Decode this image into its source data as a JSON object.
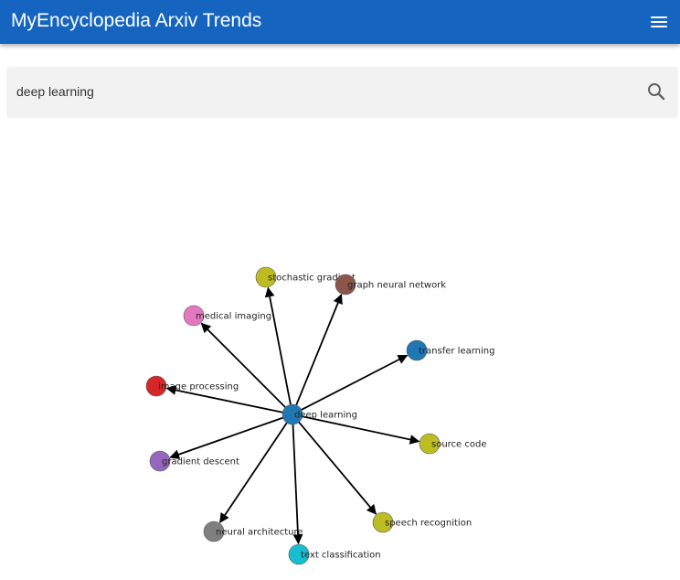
{
  "app": {
    "title": "MyEncyclopedia Arxiv Trends"
  },
  "icons": {
    "menu": "hamburger-menu-icon",
    "search": "search-icon"
  },
  "search": {
    "value": "deep learning"
  },
  "graph": {
    "center": {
      "label": "deep learning",
      "color": "#1f77b4"
    },
    "nodes": [
      {
        "label": "stochastic gradient",
        "color": "#bcbd22"
      },
      {
        "label": "graph neural network",
        "color": "#8c564b"
      },
      {
        "label": "medical imaging",
        "color": "#e377c2"
      },
      {
        "label": "transfer learning",
        "color": "#1f77b4"
      },
      {
        "label": "image processing",
        "color": "#d62728"
      },
      {
        "label": "source code",
        "color": "#bcbd22"
      },
      {
        "label": "gradient descent",
        "color": "#9467bd"
      },
      {
        "label": "speech recognition",
        "color": "#bcbd22"
      },
      {
        "label": "neural architecture",
        "color": "#7f7f7f"
      },
      {
        "label": "text classification",
        "color": "#17becf"
      }
    ]
  }
}
